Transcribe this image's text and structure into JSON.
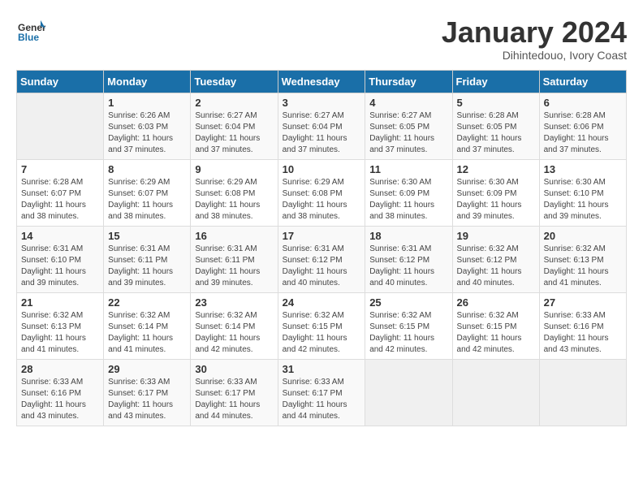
{
  "logo": {
    "general": "General",
    "blue": "Blue"
  },
  "title": "January 2024",
  "subtitle": "Dihintedouo, Ivory Coast",
  "days_header": [
    "Sunday",
    "Monday",
    "Tuesday",
    "Wednesday",
    "Thursday",
    "Friday",
    "Saturday"
  ],
  "weeks": [
    [
      {
        "day": "",
        "info": ""
      },
      {
        "day": "1",
        "info": "Sunrise: 6:26 AM\nSunset: 6:03 PM\nDaylight: 11 hours\nand 37 minutes."
      },
      {
        "day": "2",
        "info": "Sunrise: 6:27 AM\nSunset: 6:04 PM\nDaylight: 11 hours\nand 37 minutes."
      },
      {
        "day": "3",
        "info": "Sunrise: 6:27 AM\nSunset: 6:04 PM\nDaylight: 11 hours\nand 37 minutes."
      },
      {
        "day": "4",
        "info": "Sunrise: 6:27 AM\nSunset: 6:05 PM\nDaylight: 11 hours\nand 37 minutes."
      },
      {
        "day": "5",
        "info": "Sunrise: 6:28 AM\nSunset: 6:05 PM\nDaylight: 11 hours\nand 37 minutes."
      },
      {
        "day": "6",
        "info": "Sunrise: 6:28 AM\nSunset: 6:06 PM\nDaylight: 11 hours\nand 37 minutes."
      }
    ],
    [
      {
        "day": "7",
        "info": "Sunrise: 6:28 AM\nSunset: 6:07 PM\nDaylight: 11 hours\nand 38 minutes."
      },
      {
        "day": "8",
        "info": "Sunrise: 6:29 AM\nSunset: 6:07 PM\nDaylight: 11 hours\nand 38 minutes."
      },
      {
        "day": "9",
        "info": "Sunrise: 6:29 AM\nSunset: 6:08 PM\nDaylight: 11 hours\nand 38 minutes."
      },
      {
        "day": "10",
        "info": "Sunrise: 6:29 AM\nSunset: 6:08 PM\nDaylight: 11 hours\nand 38 minutes."
      },
      {
        "day": "11",
        "info": "Sunrise: 6:30 AM\nSunset: 6:09 PM\nDaylight: 11 hours\nand 38 minutes."
      },
      {
        "day": "12",
        "info": "Sunrise: 6:30 AM\nSunset: 6:09 PM\nDaylight: 11 hours\nand 39 minutes."
      },
      {
        "day": "13",
        "info": "Sunrise: 6:30 AM\nSunset: 6:10 PM\nDaylight: 11 hours\nand 39 minutes."
      }
    ],
    [
      {
        "day": "14",
        "info": "Sunrise: 6:31 AM\nSunset: 6:10 PM\nDaylight: 11 hours\nand 39 minutes."
      },
      {
        "day": "15",
        "info": "Sunrise: 6:31 AM\nSunset: 6:11 PM\nDaylight: 11 hours\nand 39 minutes."
      },
      {
        "day": "16",
        "info": "Sunrise: 6:31 AM\nSunset: 6:11 PM\nDaylight: 11 hours\nand 39 minutes."
      },
      {
        "day": "17",
        "info": "Sunrise: 6:31 AM\nSunset: 6:12 PM\nDaylight: 11 hours\nand 40 minutes."
      },
      {
        "day": "18",
        "info": "Sunrise: 6:31 AM\nSunset: 6:12 PM\nDaylight: 11 hours\nand 40 minutes."
      },
      {
        "day": "19",
        "info": "Sunrise: 6:32 AM\nSunset: 6:12 PM\nDaylight: 11 hours\nand 40 minutes."
      },
      {
        "day": "20",
        "info": "Sunrise: 6:32 AM\nSunset: 6:13 PM\nDaylight: 11 hours\nand 41 minutes."
      }
    ],
    [
      {
        "day": "21",
        "info": "Sunrise: 6:32 AM\nSunset: 6:13 PM\nDaylight: 11 hours\nand 41 minutes."
      },
      {
        "day": "22",
        "info": "Sunrise: 6:32 AM\nSunset: 6:14 PM\nDaylight: 11 hours\nand 41 minutes."
      },
      {
        "day": "23",
        "info": "Sunrise: 6:32 AM\nSunset: 6:14 PM\nDaylight: 11 hours\nand 42 minutes."
      },
      {
        "day": "24",
        "info": "Sunrise: 6:32 AM\nSunset: 6:15 PM\nDaylight: 11 hours\nand 42 minutes."
      },
      {
        "day": "25",
        "info": "Sunrise: 6:32 AM\nSunset: 6:15 PM\nDaylight: 11 hours\nand 42 minutes."
      },
      {
        "day": "26",
        "info": "Sunrise: 6:32 AM\nSunset: 6:15 PM\nDaylight: 11 hours\nand 42 minutes."
      },
      {
        "day": "27",
        "info": "Sunrise: 6:33 AM\nSunset: 6:16 PM\nDaylight: 11 hours\nand 43 minutes."
      }
    ],
    [
      {
        "day": "28",
        "info": "Sunrise: 6:33 AM\nSunset: 6:16 PM\nDaylight: 11 hours\nand 43 minutes."
      },
      {
        "day": "29",
        "info": "Sunrise: 6:33 AM\nSunset: 6:17 PM\nDaylight: 11 hours\nand 43 minutes."
      },
      {
        "day": "30",
        "info": "Sunrise: 6:33 AM\nSunset: 6:17 PM\nDaylight: 11 hours\nand 44 minutes."
      },
      {
        "day": "31",
        "info": "Sunrise: 6:33 AM\nSunset: 6:17 PM\nDaylight: 11 hours\nand 44 minutes."
      },
      {
        "day": "",
        "info": ""
      },
      {
        "day": "",
        "info": ""
      },
      {
        "day": "",
        "info": ""
      }
    ]
  ]
}
